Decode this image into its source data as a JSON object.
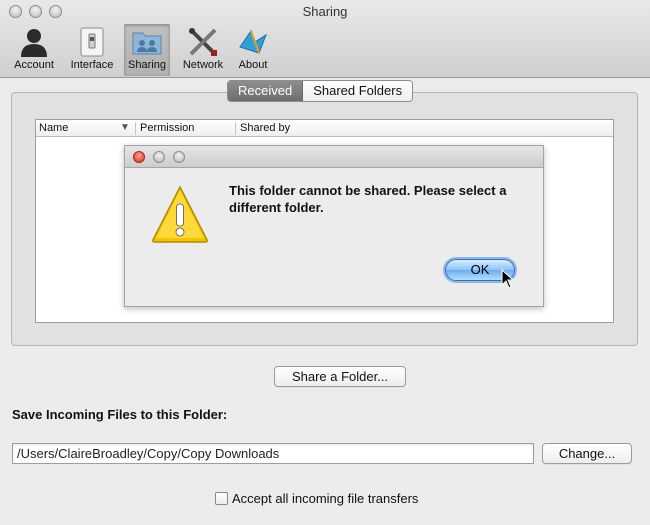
{
  "window": {
    "title": "Sharing"
  },
  "toolbar": {
    "items": [
      {
        "label": "Account",
        "icon": "account-icon"
      },
      {
        "label": "Interface",
        "icon": "interface-icon"
      },
      {
        "label": "Sharing",
        "icon": "sharing-icon",
        "active": true
      },
      {
        "label": "Network",
        "icon": "network-icon"
      },
      {
        "label": "About",
        "icon": "about-icon"
      }
    ]
  },
  "tabs": {
    "received": "Received",
    "shared_folders": "Shared Folders",
    "active": "Received"
  },
  "table": {
    "columns": [
      "Name",
      "Permission",
      "Shared by"
    ]
  },
  "dialog": {
    "message": "This folder cannot be shared. Please select a different folder.",
    "ok_label": "OK",
    "icon": "warning-icon"
  },
  "share_button": "Share a Folder...",
  "save_section": {
    "label": "Save Incoming Files to this Folder:",
    "path": "/Users/ClaireBroadley/Copy/Copy Downloads",
    "change_label": "Change..."
  },
  "accept_checkbox": {
    "label": "Accept all incoming file transfers",
    "checked": false
  },
  "colors": {
    "ok_accent": "#6aaef0",
    "close_red": "#d23620",
    "warning_yellow": "#f5c400"
  }
}
